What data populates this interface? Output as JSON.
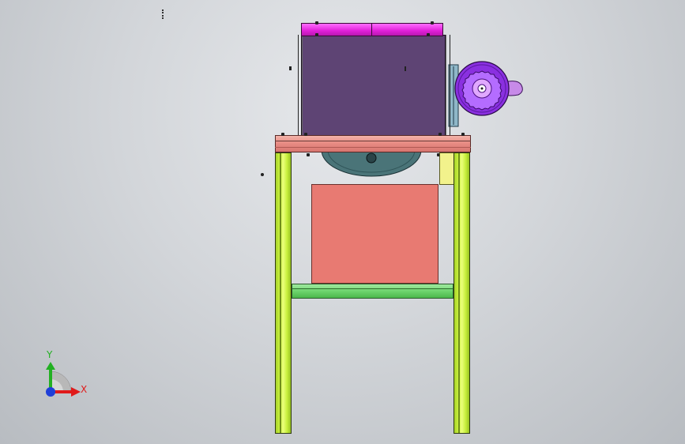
{
  "triad": {
    "x_label": "X",
    "y_label": "Y",
    "x_color": "#e01a1a",
    "y_color": "#22b022",
    "z_color": "#1f3fd8"
  },
  "colors": {
    "background": "#d3d6da",
    "legs": "#c8f03c",
    "crossbar": "#6ed46e",
    "tabletop": "#e88c84",
    "lower_box": "#e87a72",
    "hopper": "#5e4474",
    "lid": "#e020d8",
    "motor": "#9a3ce8",
    "blade": "#4a7478",
    "bracket": "#f2f28c"
  }
}
